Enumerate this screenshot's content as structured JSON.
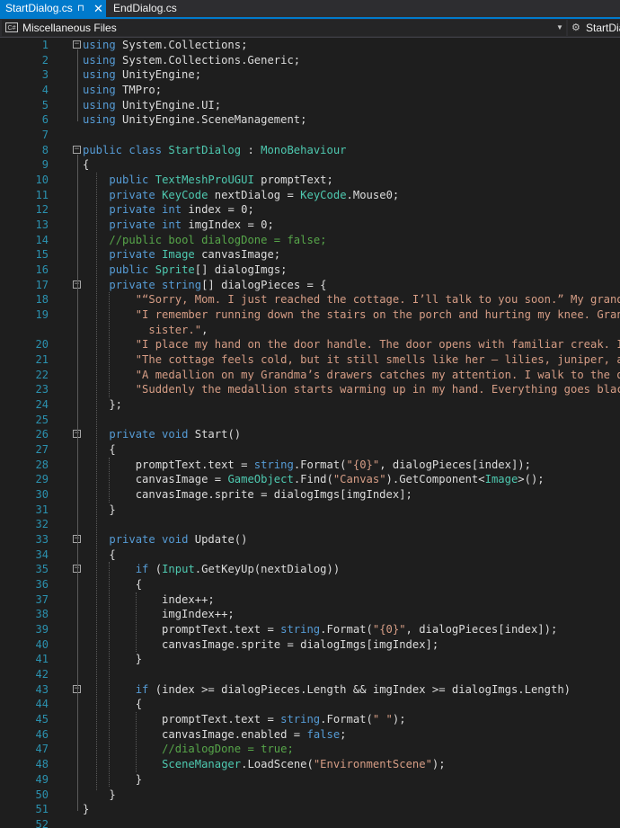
{
  "tabs": [
    {
      "label": "StartDialog.cs",
      "pin": "⊓",
      "close": "✕"
    },
    {
      "label": "EndDialog.cs"
    }
  ],
  "navbar": {
    "project_icon_text": "C#",
    "project": "Miscellaneous Files",
    "type": "StartDialog"
  },
  "colors": {
    "keyword": "#569cd6",
    "type": "#4ec9b0",
    "string": "#d69d85",
    "comment": "#57a64a",
    "text": "#dcdcdc",
    "linenum": "#2b91af"
  },
  "lines": [
    {
      "n": "1",
      "tokens": [
        [
          "k",
          "using"
        ],
        [
          "t",
          " System.Collections;"
        ]
      ]
    },
    {
      "n": "2",
      "tokens": [
        [
          "k",
          "using"
        ],
        [
          "t",
          " System.Collections.Generic;"
        ]
      ]
    },
    {
      "n": "3",
      "tokens": [
        [
          "k",
          "using"
        ],
        [
          "t",
          " UnityEngine;"
        ]
      ]
    },
    {
      "n": "4",
      "tokens": [
        [
          "k",
          "using"
        ],
        [
          "t",
          " TMPro;"
        ]
      ]
    },
    {
      "n": "5",
      "tokens": [
        [
          "k",
          "using"
        ],
        [
          "t",
          " UnityEngine.UI;"
        ]
      ]
    },
    {
      "n": "6",
      "tokens": [
        [
          "k",
          "using"
        ],
        [
          "t",
          " UnityEngine.SceneManagement;"
        ]
      ]
    },
    {
      "n": "7",
      "tokens": []
    },
    {
      "n": "8",
      "tokens": [
        [
          "k",
          "public class "
        ],
        [
          "y",
          "StartDialog"
        ],
        [
          "t",
          " : "
        ],
        [
          "y",
          "MonoBehaviour"
        ]
      ]
    },
    {
      "n": "9",
      "tokens": [
        [
          "t",
          "{"
        ]
      ]
    },
    {
      "n": "10",
      "tokens": [
        [
          "t",
          "    "
        ],
        [
          "k",
          "public "
        ],
        [
          "y",
          "TextMeshProUGUI"
        ],
        [
          "t",
          " promptText;"
        ]
      ]
    },
    {
      "n": "11",
      "tokens": [
        [
          "t",
          "    "
        ],
        [
          "k",
          "private "
        ],
        [
          "y",
          "KeyCode"
        ],
        [
          "t",
          " nextDialog = "
        ],
        [
          "y",
          "KeyCode"
        ],
        [
          "t",
          ".Mouse0;"
        ]
      ]
    },
    {
      "n": "12",
      "tokens": [
        [
          "t",
          "    "
        ],
        [
          "k",
          "private int"
        ],
        [
          "t",
          " index = 0;"
        ]
      ]
    },
    {
      "n": "13",
      "tokens": [
        [
          "t",
          "    "
        ],
        [
          "k",
          "private int"
        ],
        [
          "t",
          " imgIndex = 0;"
        ]
      ]
    },
    {
      "n": "14",
      "tokens": [
        [
          "t",
          "    "
        ],
        [
          "c",
          "//public bool dialogDone = false;"
        ]
      ]
    },
    {
      "n": "15",
      "tokens": [
        [
          "t",
          "    "
        ],
        [
          "k",
          "private "
        ],
        [
          "y",
          "Image"
        ],
        [
          "t",
          " canvasImage;"
        ]
      ]
    },
    {
      "n": "16",
      "tokens": [
        [
          "t",
          "    "
        ],
        [
          "k",
          "public "
        ],
        [
          "y",
          "Sprite"
        ],
        [
          "t",
          "[] dialogImgs;"
        ]
      ]
    },
    {
      "n": "17",
      "tokens": [
        [
          "t",
          "    "
        ],
        [
          "k",
          "private string"
        ],
        [
          "t",
          "[] dialogPieces = {"
        ]
      ]
    },
    {
      "n": "18",
      "tokens": [
        [
          "t",
          "        "
        ],
        [
          "s",
          "\"“Sorry, Mom. I just reached the cottage. I’ll talk to you soon.” My grandma’s"
        ]
      ]
    },
    {
      "n": "19",
      "tokens": [
        [
          "t",
          "        "
        ],
        [
          "s",
          "\"I remember running down the stairs on the porch and hurting my knee. Grandma"
        ]
      ]
    },
    {
      "n": "",
      "tokens": [
        [
          "t",
          "          "
        ],
        [
          "s",
          "sister.\""
        ],
        [
          "t",
          ","
        ]
      ]
    },
    {
      "n": "20",
      "tokens": [
        [
          "t",
          "        "
        ],
        [
          "s",
          "\"I place my hand on the door handle. The door opens with familiar creak. I ste"
        ]
      ]
    },
    {
      "n": "21",
      "tokens": [
        [
          "t",
          "        "
        ],
        [
          "s",
          "\"The cottage feels cold, but it still smells like her – lilies, juniper, and h"
        ]
      ]
    },
    {
      "n": "22",
      "tokens": [
        [
          "t",
          "        "
        ],
        [
          "s",
          "\"A medallion on my Grandma’s drawers catches my attention. I walk to the drawe"
        ]
      ]
    },
    {
      "n": "23",
      "tokens": [
        [
          "t",
          "        "
        ],
        [
          "s",
          "\"Suddenly the medallion starts warming up in my hand. Everything goes black an"
        ]
      ]
    },
    {
      "n": "24",
      "tokens": [
        [
          "t",
          "    };"
        ]
      ]
    },
    {
      "n": "25",
      "tokens": []
    },
    {
      "n": "26",
      "tokens": [
        [
          "t",
          "    "
        ],
        [
          "k",
          "private void"
        ],
        [
          "t",
          " Start()"
        ]
      ]
    },
    {
      "n": "27",
      "tokens": [
        [
          "t",
          "    {"
        ]
      ]
    },
    {
      "n": "28",
      "tokens": [
        [
          "t",
          "        promptText.text = "
        ],
        [
          "k",
          "string"
        ],
        [
          "t",
          ".Format("
        ],
        [
          "s",
          "\"{0}\""
        ],
        [
          "t",
          ", dialogPieces[index]);"
        ]
      ]
    },
    {
      "n": "29",
      "tokens": [
        [
          "t",
          "        canvasImage = "
        ],
        [
          "y",
          "GameObject"
        ],
        [
          "t",
          ".Find("
        ],
        [
          "s",
          "\"Canvas\""
        ],
        [
          "t",
          ").GetComponent<"
        ],
        [
          "y",
          "Image"
        ],
        [
          "t",
          ">();"
        ]
      ]
    },
    {
      "n": "30",
      "tokens": [
        [
          "t",
          "        canvasImage.sprite = dialogImgs[imgIndex];"
        ]
      ]
    },
    {
      "n": "31",
      "tokens": [
        [
          "t",
          "    }"
        ]
      ]
    },
    {
      "n": "32",
      "tokens": []
    },
    {
      "n": "33",
      "tokens": [
        [
          "t",
          "    "
        ],
        [
          "k",
          "private void"
        ],
        [
          "t",
          " Update()"
        ]
      ]
    },
    {
      "n": "34",
      "tokens": [
        [
          "t",
          "    {"
        ]
      ]
    },
    {
      "n": "35",
      "tokens": [
        [
          "t",
          "        "
        ],
        [
          "k",
          "if"
        ],
        [
          "t",
          " ("
        ],
        [
          "y",
          "Input"
        ],
        [
          "t",
          ".GetKeyUp(nextDialog))"
        ]
      ]
    },
    {
      "n": "36",
      "tokens": [
        [
          "t",
          "        {"
        ]
      ]
    },
    {
      "n": "37",
      "tokens": [
        [
          "t",
          "            index++;"
        ]
      ]
    },
    {
      "n": "38",
      "tokens": [
        [
          "t",
          "            imgIndex++;"
        ]
      ]
    },
    {
      "n": "39",
      "tokens": [
        [
          "t",
          "            promptText.text = "
        ],
        [
          "k",
          "string"
        ],
        [
          "t",
          ".Format("
        ],
        [
          "s",
          "\"{0}\""
        ],
        [
          "t",
          ", dialogPieces[index]);"
        ]
      ]
    },
    {
      "n": "40",
      "tokens": [
        [
          "t",
          "            canvasImage.sprite = dialogImgs[imgIndex];"
        ]
      ]
    },
    {
      "n": "41",
      "tokens": [
        [
          "t",
          "        }"
        ]
      ]
    },
    {
      "n": "42",
      "tokens": []
    },
    {
      "n": "43",
      "tokens": [
        [
          "t",
          "        "
        ],
        [
          "k",
          "if"
        ],
        [
          "t",
          " (index >= dialogPieces.Length && imgIndex >= dialogImgs.Length)"
        ]
      ]
    },
    {
      "n": "44",
      "tokens": [
        [
          "t",
          "        {"
        ]
      ]
    },
    {
      "n": "45",
      "tokens": [
        [
          "t",
          "            promptText.text = "
        ],
        [
          "k",
          "string"
        ],
        [
          "t",
          ".Format("
        ],
        [
          "s",
          "\" \""
        ],
        [
          "t",
          ");"
        ]
      ]
    },
    {
      "n": "46",
      "tokens": [
        [
          "t",
          "            canvasImage.enabled = "
        ],
        [
          "k",
          "false"
        ],
        [
          "t",
          ";"
        ]
      ]
    },
    {
      "n": "47",
      "tokens": [
        [
          "t",
          "            "
        ],
        [
          "c",
          "//dialogDone = true;"
        ]
      ]
    },
    {
      "n": "48",
      "tokens": [
        [
          "t",
          "            "
        ],
        [
          "y",
          "SceneManager"
        ],
        [
          "t",
          ".LoadScene("
        ],
        [
          "s",
          "\"EnvironmentScene\""
        ],
        [
          "t",
          ");"
        ]
      ]
    },
    {
      "n": "49",
      "tokens": [
        [
          "t",
          "        }"
        ]
      ]
    },
    {
      "n": "50",
      "tokens": [
        [
          "t",
          "    }"
        ]
      ]
    },
    {
      "n": "51",
      "tokens": [
        [
          "t",
          "}"
        ]
      ]
    },
    {
      "n": "52",
      "tokens": []
    }
  ],
  "folds": [
    "1",
    "8",
    "17",
    "26",
    "33",
    "35",
    "43"
  ]
}
